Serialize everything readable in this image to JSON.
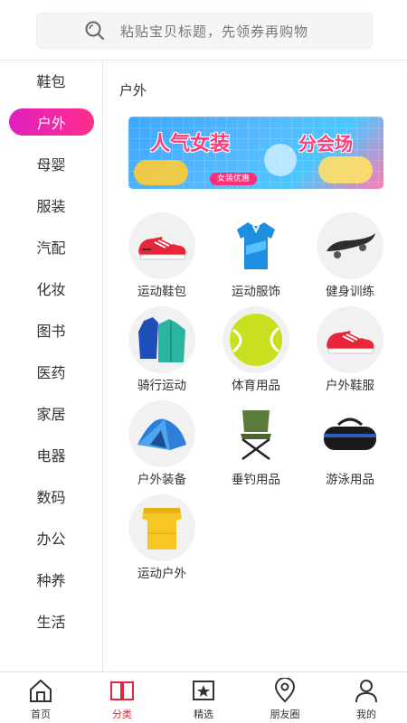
{
  "search": {
    "placeholder": "粘贴宝贝标题，先领券再购物"
  },
  "sidebar": {
    "items": [
      {
        "label": "鞋包"
      },
      {
        "label": "户外"
      },
      {
        "label": "母婴"
      },
      {
        "label": "服装"
      },
      {
        "label": "汽配"
      },
      {
        "label": "化妆"
      },
      {
        "label": "图书"
      },
      {
        "label": "医药"
      },
      {
        "label": "家居"
      },
      {
        "label": "电器"
      },
      {
        "label": "数码"
      },
      {
        "label": "办公"
      },
      {
        "label": "种养"
      },
      {
        "label": "生活"
      }
    ],
    "active_index": 1
  },
  "content": {
    "title": "户外",
    "banner": {
      "headline": "人气女装",
      "sub": "分会场",
      "chip": "女装优惠"
    },
    "categories": [
      {
        "label": "运动鞋包",
        "icon": "running-shoe-icon"
      },
      {
        "label": "运动服饰",
        "icon": "sport-shirt-icon"
      },
      {
        "label": "健身训练",
        "icon": "skateboard-icon"
      },
      {
        "label": "骑行运动",
        "icon": "jacket-icon"
      },
      {
        "label": "体育用品",
        "icon": "tennis-ball-icon"
      },
      {
        "label": "户外鞋服",
        "icon": "outdoor-shoe-icon"
      },
      {
        "label": "户外装备",
        "icon": "tent-icon"
      },
      {
        "label": "垂钓用品",
        "icon": "folding-chair-icon"
      },
      {
        "label": "游泳用品",
        "icon": "duffel-bag-icon"
      },
      {
        "label": "运动户外",
        "icon": "yellow-top-icon"
      }
    ]
  },
  "tabbar": {
    "tabs": [
      {
        "label": "首页",
        "icon": "home-icon"
      },
      {
        "label": "分类",
        "icon": "book-icon"
      },
      {
        "label": "精选",
        "icon": "star-page-icon"
      },
      {
        "label": "朋友圈",
        "icon": "location-pin-icon"
      },
      {
        "label": "我的",
        "icon": "user-icon"
      }
    ],
    "active_index": 1
  },
  "colors": {
    "accent": "#e5243f",
    "sidebar_active_start": "#e020c0",
    "sidebar_active_end": "#ff2d8a"
  }
}
